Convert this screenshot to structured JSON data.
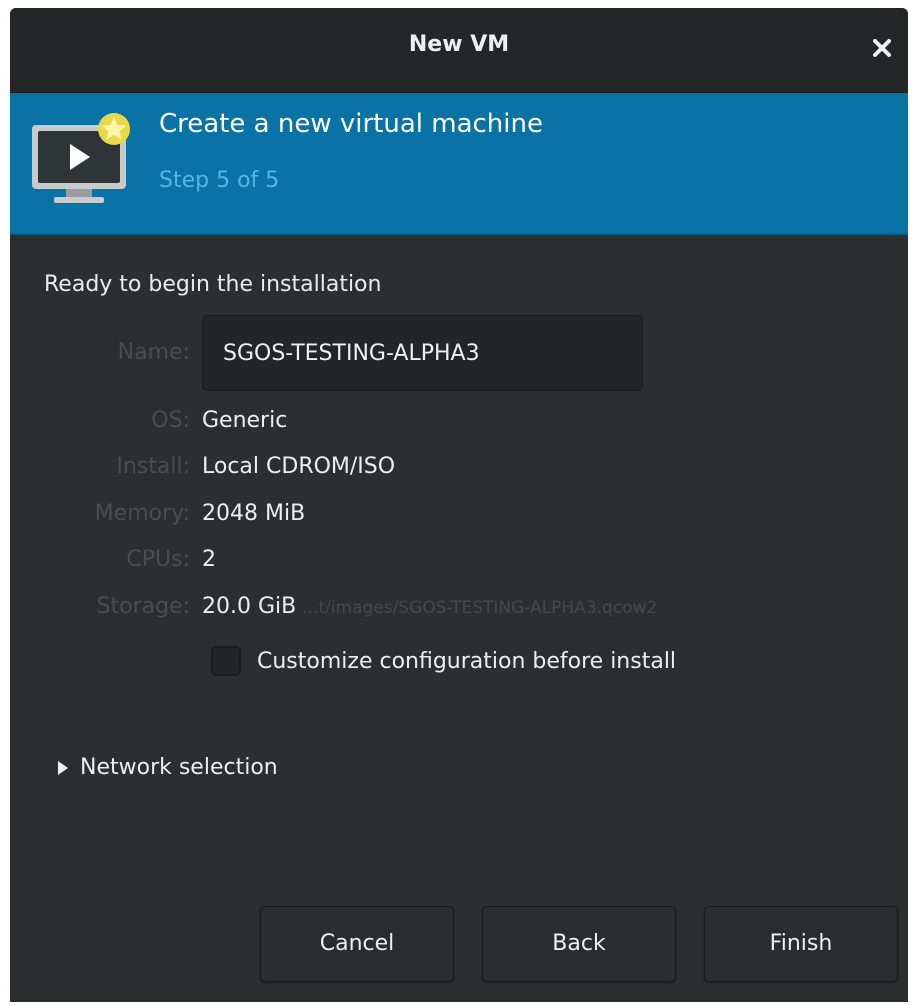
{
  "window": {
    "title": "New VM"
  },
  "header": {
    "title": "Create a new virtual machine",
    "step": "Step 5 of 5"
  },
  "summary": {
    "heading": "Ready to begin the installation",
    "name_label": "Name:",
    "name_value": "SGOS-TESTING-ALPHA3",
    "os_label": "OS:",
    "os_value": "Generic",
    "install_label": "Install:",
    "install_value": "Local CDROM/ISO",
    "memory_label": "Memory:",
    "memory_value": "2048 MiB",
    "cpus_label": "CPUs:",
    "cpus_value": "2",
    "storage_label": "Storage:",
    "storage_value": "20.0 GiB",
    "storage_path": "...t/images/SGOS-TESTING-ALPHA3.qcow2"
  },
  "customize": {
    "label": "Customize configuration before install",
    "checked": false
  },
  "network": {
    "label": "Network selection",
    "expanded": false
  },
  "buttons": {
    "cancel": "Cancel",
    "back": "Back",
    "finish": "Finish"
  },
  "icons": {
    "close": "close-icon",
    "vm": "new-vm-icon",
    "expander": "triangle-right-icon"
  },
  "colors": {
    "header_bg": "#0a73a6",
    "step_text": "#54b6e3",
    "window_bg": "#2c2e30",
    "titlebar_bg": "#242627"
  }
}
